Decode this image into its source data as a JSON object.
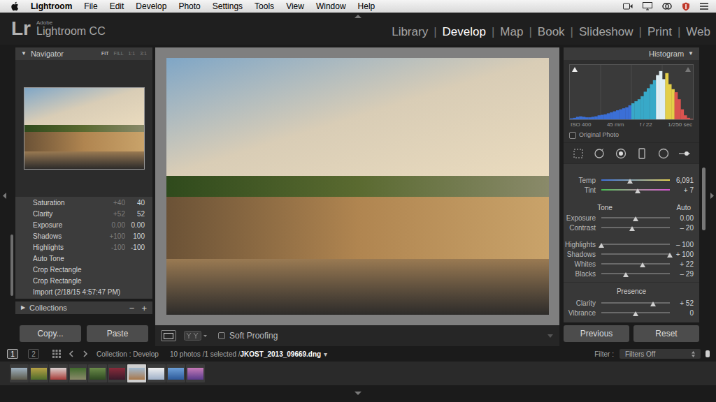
{
  "menubar": {
    "app_name": "Lightroom",
    "items": [
      "File",
      "Edit",
      "Develop",
      "Photo",
      "Settings",
      "Tools",
      "View",
      "Window",
      "Help"
    ]
  },
  "app": {
    "logo": "Lr",
    "brand_small": "Adobe",
    "brand": "Lightroom CC"
  },
  "modules": {
    "separator": "|",
    "items": [
      {
        "label": "Library",
        "selected": false
      },
      {
        "label": "Develop",
        "selected": true
      },
      {
        "label": "Map",
        "selected": false
      },
      {
        "label": "Book",
        "selected": false
      },
      {
        "label": "Slideshow",
        "selected": false
      },
      {
        "label": "Print",
        "selected": false
      },
      {
        "label": "Web",
        "selected": false
      }
    ]
  },
  "navigator": {
    "toggle": "▼",
    "title": "Navigator",
    "zoom": [
      {
        "label": "FIT",
        "selected": true
      },
      {
        "label": "FILL",
        "selected": false
      },
      {
        "label": "1:1",
        "selected": false
      },
      {
        "label": "3:1",
        "selected": false
      }
    ]
  },
  "history": [
    {
      "label": "Saturation",
      "before": "+40",
      "after": "40"
    },
    {
      "label": "Clarity",
      "before": "+52",
      "after": "52"
    },
    {
      "label": "Exposure",
      "before": "0.00",
      "after": "0.00"
    },
    {
      "label": "Shadows",
      "before": "+100",
      "after": "100"
    },
    {
      "label": "Highlights",
      "before": "-100",
      "after": "-100"
    },
    {
      "label": "Auto Tone"
    },
    {
      "label": "Crop Rectangle"
    },
    {
      "label": "Crop Rectangle"
    },
    {
      "label": "Import (2/18/15 4:57:47 PM)"
    }
  ],
  "collections": {
    "toggle": "▶",
    "title": "Collections",
    "remove": "−",
    "add": "+"
  },
  "left_buttons": [
    "Copy...",
    "Paste"
  ],
  "toolbar": {
    "soft_proofing": {
      "label": "Soft Proofing",
      "checked": false
    }
  },
  "histogram": {
    "title": "Histogram",
    "toggle": "▼",
    "values": [
      2,
      3,
      5,
      6,
      5,
      4,
      4,
      5,
      6,
      8,
      9,
      10,
      12,
      14,
      16,
      18,
      20,
      22,
      24,
      28,
      32,
      36,
      40,
      46,
      55,
      62,
      70,
      78,
      88,
      96,
      80,
      92,
      70,
      60,
      54,
      40,
      20,
      8,
      3,
      1
    ],
    "info": [
      "ISO 400",
      "45 mm",
      "f / 22",
      "1/250 sec"
    ],
    "original_photo": {
      "label": "Original Photo",
      "checked": false
    }
  },
  "basic": {
    "white_balance": [
      {
        "label": "Temp",
        "reading": "6,091",
        "level": 0.42,
        "kind": "temp"
      },
      {
        "label": "Tint",
        "reading": "+ 7",
        "level": 0.53,
        "kind": "tint"
      }
    ],
    "tone": {
      "title": "Tone",
      "auto": "Auto",
      "groups": [
        [
          {
            "label": "Exposure",
            "reading": "0.00",
            "level": 0.5,
            "kind": "plain"
          },
          {
            "label": "Contrast",
            "reading": "– 20",
            "level": 0.45,
            "kind": "plain"
          }
        ],
        [
          {
            "label": "Highlights",
            "reading": "– 100",
            "level": 0.0,
            "kind": "plain"
          },
          {
            "label": "Shadows",
            "reading": "+ 100",
            "level": 1.0,
            "kind": "plain"
          },
          {
            "label": "Whites",
            "reading": "+ 22",
            "level": 0.6,
            "kind": "plain"
          },
          {
            "label": "Blacks",
            "reading": "– 29",
            "level": 0.36,
            "kind": "plain"
          }
        ]
      ]
    },
    "presence": {
      "title": "Presence",
      "sliders": [
        {
          "label": "Clarity",
          "reading": "+ 52",
          "level": 0.76,
          "kind": "plain"
        },
        {
          "label": "Vibrance",
          "reading": "0",
          "level": 0.5,
          "kind": "plain"
        }
      ]
    }
  },
  "right_buttons": [
    "Previous",
    "Reset"
  ],
  "filmstrip": {
    "pages": [
      {
        "label": "1",
        "selected": true
      },
      {
        "label": "2",
        "selected": false
      }
    ],
    "source": "Collection : Develop",
    "count": "10 photos /1 selected /",
    "file": "JKOST_2013_09669.dng",
    "file_menu": "▾",
    "filter_label": "Filter :",
    "filter_value": "Filters Off",
    "thumbnails": [
      {
        "selected": false
      },
      {
        "selected": false
      },
      {
        "selected": false
      },
      {
        "selected": false
      },
      {
        "selected": false
      },
      {
        "selected": false
      },
      {
        "selected": true
      },
      {
        "selected": false
      },
      {
        "selected": false
      },
      {
        "selected": false
      }
    ]
  }
}
